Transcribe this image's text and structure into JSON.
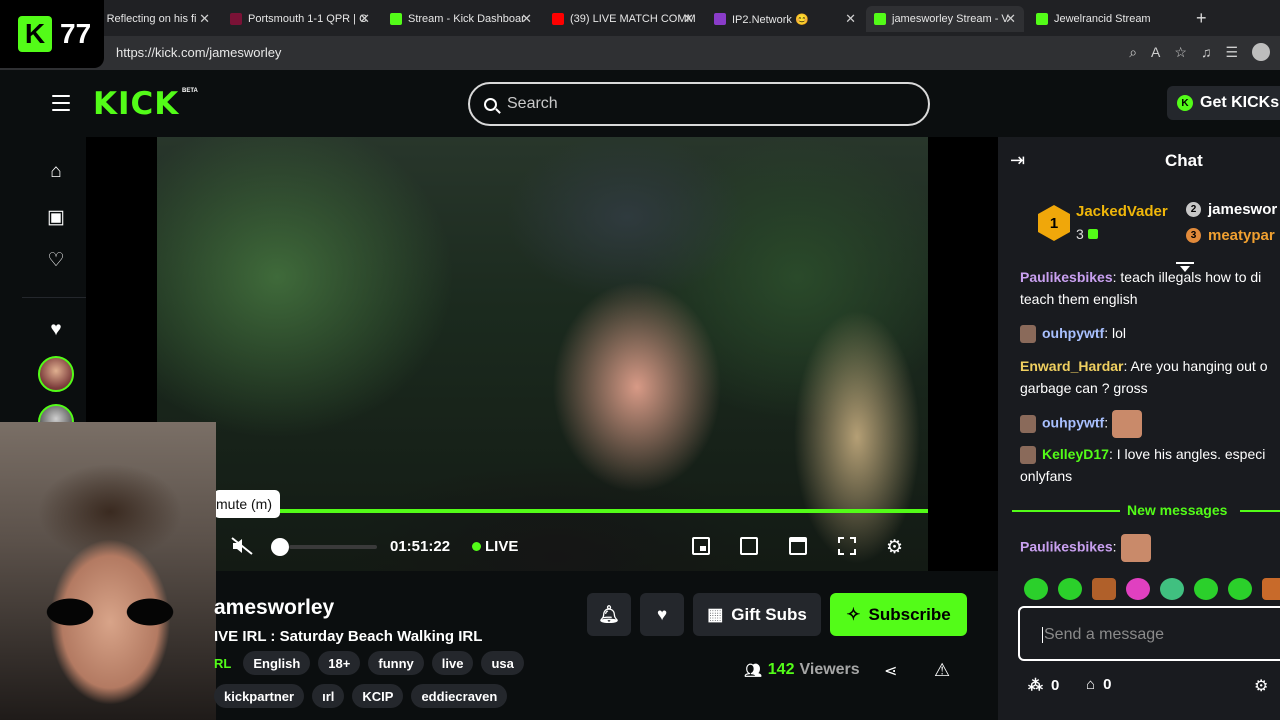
{
  "browser": {
    "tabs": [
      {
        "label": "(39) Reflecting on his fi",
        "favicon_color": "#ff0000"
      },
      {
        "label": "Portsmouth 1-1 QPR | C",
        "favicon_color": "#7a1236"
      },
      {
        "label": "Stream - Kick Dashboar",
        "favicon_color": "#53fc18"
      },
      {
        "label": "(39) LIVE MATCH COMM",
        "favicon_color": "#ff0000"
      },
      {
        "label": "IP2.Network 😊",
        "favicon_color": "#8a3cc9"
      },
      {
        "label": "jamesworley Stream - V",
        "favicon_color": "#53fc18"
      },
      {
        "label": "Jewelrancid Stream",
        "favicon_color": "#53fc18"
      }
    ],
    "url": "https://kick.com/jamesworley",
    "close_glyph": "✕",
    "new_tab_glyph": "+"
  },
  "overlay": {
    "badge_letter": "K",
    "badge_number": "77"
  },
  "header": {
    "logo": "KICK",
    "beta": "BETA",
    "search_placeholder": "Search",
    "get_kicks": "Get KICKs",
    "accent_color": "#53fc18"
  },
  "sidebar": {
    "icons": [
      "home-icon",
      "browse-icon",
      "following-icon",
      "favorites-icon"
    ]
  },
  "player": {
    "tooltip": "mute (m)",
    "time": "01:51:22",
    "live_label": "LIVE"
  },
  "channel": {
    "name": "amesworley",
    "title": "IVE IRL : Saturday Beach Walking IRL",
    "category": "RL",
    "tags_row1": [
      "English",
      "18+",
      "funny",
      "live",
      "usa"
    ],
    "tags_row2": [
      "kickpartner",
      "ırl",
      "KCIP",
      "eddiecraven"
    ],
    "gift_subs": "Gift Subs",
    "subscribe": "Subscribe",
    "viewers_count": "142",
    "viewers_label": "Viewers"
  },
  "chat": {
    "title": "Chat",
    "top_gifters": [
      {
        "rank": "1",
        "name": "JackedVader",
        "count": "3"
      },
      {
        "rank": "2",
        "name": "jameswor"
      },
      {
        "rank": "3",
        "name": "meatypar"
      }
    ],
    "messages": [
      {
        "user": "Paulikesbikes",
        "text": "teach illegals how to di",
        "continued": "teach them english",
        "color": "#c9a0f0"
      },
      {
        "user": "ouhpywtf",
        "text": "lol",
        "color": "#a8c0ff"
      },
      {
        "user": "Enward_Hardar",
        "text": "Are you hanging out o",
        "continued": "garbage can ? gross",
        "color": "#f0d060"
      },
      {
        "user": "ouhpywtf",
        "text": "",
        "color": "#a8c0ff"
      },
      {
        "user": "KelleyD17",
        "text": "I love his angles. especi",
        "continued": "onlyfans",
        "color": "#53fc18"
      },
      {
        "user": "Paulikesbikes",
        "text": "",
        "color": "#c9a0f0"
      }
    ],
    "new_messages": "New messages",
    "input_placeholder": "Send a message",
    "points": "0",
    "store": "0"
  }
}
